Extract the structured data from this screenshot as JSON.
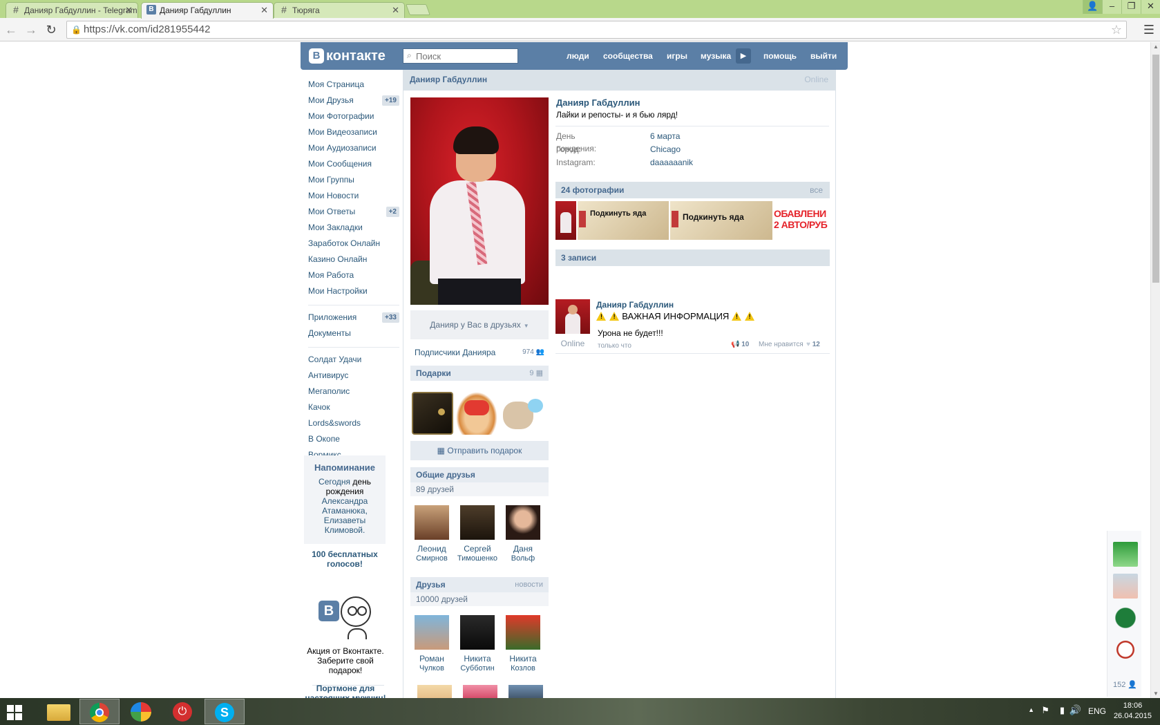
{
  "browser": {
    "tabs": [
      {
        "title": "Данияр Габдуллин - Telegram"
      },
      {
        "title": "Данияр Габдуллин"
      },
      {
        "title": "Тюряга"
      }
    ],
    "url": "https://vk.com/id281955442"
  },
  "vk_header": {
    "logo_text": "контакте",
    "logo_letter": "В",
    "search_placeholder": "Поиск",
    "nav": [
      "люди",
      "сообщества",
      "игры",
      "музыка",
      "помощь",
      "выйти"
    ]
  },
  "left_menu": {
    "items": [
      {
        "label": "Моя Страница",
        "count": ""
      },
      {
        "label": "Мои Друзья",
        "count": "+19"
      },
      {
        "label": "Мои Фотографии",
        "count": ""
      },
      {
        "label": "Мои Видеозаписи",
        "count": ""
      },
      {
        "label": "Мои Аудиозаписи",
        "count": ""
      },
      {
        "label": "Мои Сообщения",
        "count": ""
      },
      {
        "label": "Мои Группы",
        "count": ""
      },
      {
        "label": "Мои Новости",
        "count": ""
      },
      {
        "label": "Мои Ответы",
        "count": "+2"
      },
      {
        "label": "Мои Закладки",
        "count": ""
      },
      {
        "label": "Заработок Онлайн",
        "count": ""
      },
      {
        "label": "Казино Онлайн",
        "count": ""
      },
      {
        "label": "Моя Работа",
        "count": ""
      },
      {
        "label": "Мои Настройки",
        "count": ""
      }
    ],
    "apps": [
      {
        "label": "Приложения",
        "count": "+33"
      },
      {
        "label": "Документы",
        "count": ""
      }
    ],
    "games": [
      "Солдат Удачи",
      "Антивирус",
      "Мегаполис",
      "Качок",
      "Lords&swords",
      "В Окопе",
      "Вормикс"
    ],
    "reminder": {
      "title": "Напоминание",
      "today": "Сегодня",
      "text1": "день рождения",
      "names": "Александра Атаманюка, Елизаветы Климовой."
    },
    "votes": "100 бесплатных голосов!",
    "promo": "Акция от Вконтакте. Заберите свой подарок!",
    "portmone": "Портмоне для настоящих мужчин!"
  },
  "profile": {
    "header_name": "Данияр Габдуллин",
    "online": "Online",
    "name": "Данияр Габдуллин",
    "status": "Лайки и репосты- и я бью лярд!",
    "info": [
      {
        "label": "День рождения:",
        "value": "6 марта"
      },
      {
        "label": "Город:",
        "value": "Chicago"
      },
      {
        "label": "Instagram:",
        "value": "daaaaaanik"
      }
    ],
    "friends_button": "Данияр у Вас в друзьях",
    "followers_label": "Подписчики Данияра",
    "followers_count": "974",
    "gifts_title": "Подарки",
    "gifts_count": "9",
    "send_gift": "Отправить подарок",
    "mutual_title": "Общие друзья",
    "mutual_count": "89 друзей",
    "mutual": [
      {
        "first": "Леонид",
        "last": "Смирнов"
      },
      {
        "first": "Сергей",
        "last": "Тимошенко"
      },
      {
        "first": "Даня",
        "last": "Вольф"
      }
    ],
    "friends_title": "Друзья",
    "friends_news": "новости",
    "friends_count": "10000 друзей",
    "friends": [
      {
        "first": "Роман",
        "last": "Чулков"
      },
      {
        "first": "Никита",
        "last": "Субботин"
      },
      {
        "first": "Никита",
        "last": "Козлов"
      }
    ],
    "photos_title": "24 фотографии",
    "photos_all": "все",
    "photo_caption_1": "Подкинуть яда",
    "photo_caption_2": "Подкинуть яда",
    "photo_caption_3": "ОБАВЛЕНИ",
    "photo_caption_3b": "2 АВТО/РУБ",
    "posts_title": "3 записи",
    "post": {
      "author": "Данияр Габдуллин",
      "title": "ВАЖНАЯ ИНФОРМАЦИЯ",
      "text": "Урона не будет!!!",
      "online": "Online",
      "time": "только что",
      "reposts": "10",
      "like_label": "Мне нравится",
      "likes": "12"
    }
  },
  "chat": {
    "count": "152"
  },
  "taskbar": {
    "lang": "ENG",
    "time": "18:06",
    "date": "26.04.2015"
  },
  "colors": {
    "vk_blue": "#5b7fa6",
    "link": "#2b587a",
    "chrome_green": "#b8d88b"
  }
}
